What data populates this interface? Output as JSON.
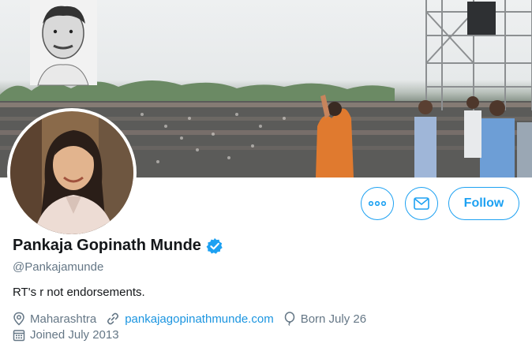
{
  "profile": {
    "name": "Pankaja Gopinath Munde",
    "handle": "@Pankajamunde",
    "bio": "RT's r not endorsements.",
    "location": "Maharashtra",
    "website": "pankajagopinathmunde.com",
    "birthday": "Born July 26",
    "joined": "Joined July 2013"
  },
  "actions": {
    "more_icon": "more-dots-icon",
    "message_icon": "envelope-icon",
    "follow_label": "Follow"
  },
  "colors": {
    "accent": "#1da1f2",
    "link": "#1b95e0",
    "secondary_text": "#657786",
    "primary_text": "#14171a"
  }
}
